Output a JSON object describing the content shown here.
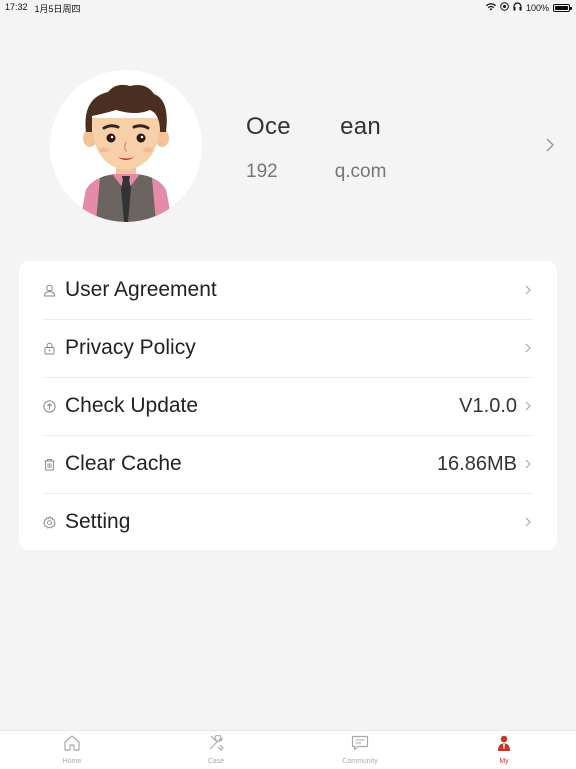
{
  "status_bar": {
    "time": "17:32",
    "date": "1月5日周四",
    "battery": "100%"
  },
  "profile": {
    "name": "Oce    ean",
    "email": "192      q.com"
  },
  "menu": {
    "items": [
      {
        "label": "User Agreement",
        "value": "",
        "icon": "user-icon"
      },
      {
        "label": "Privacy Policy",
        "value": "",
        "icon": "lock-icon"
      },
      {
        "label": "Check Update",
        "value": "V1.0.0",
        "icon": "upload-arrow-icon"
      },
      {
        "label": "Clear Cache",
        "value": "16.86MB",
        "icon": "trash-icon"
      },
      {
        "label": "Setting",
        "value": "",
        "icon": "gear-icon"
      }
    ]
  },
  "tabs": [
    {
      "label": "Home",
      "icon": "home-icon",
      "active": false
    },
    {
      "label": "Case",
      "icon": "tools-icon",
      "active": false
    },
    {
      "label": "Community",
      "icon": "chat-icon",
      "active": false
    },
    {
      "label": "My",
      "icon": "person-icon",
      "active": true
    }
  ],
  "colors": {
    "background": "#f4f4f4",
    "card": "#ffffff",
    "active_tab": "#c0392b",
    "inactive_tab": "#aaaaaa"
  }
}
